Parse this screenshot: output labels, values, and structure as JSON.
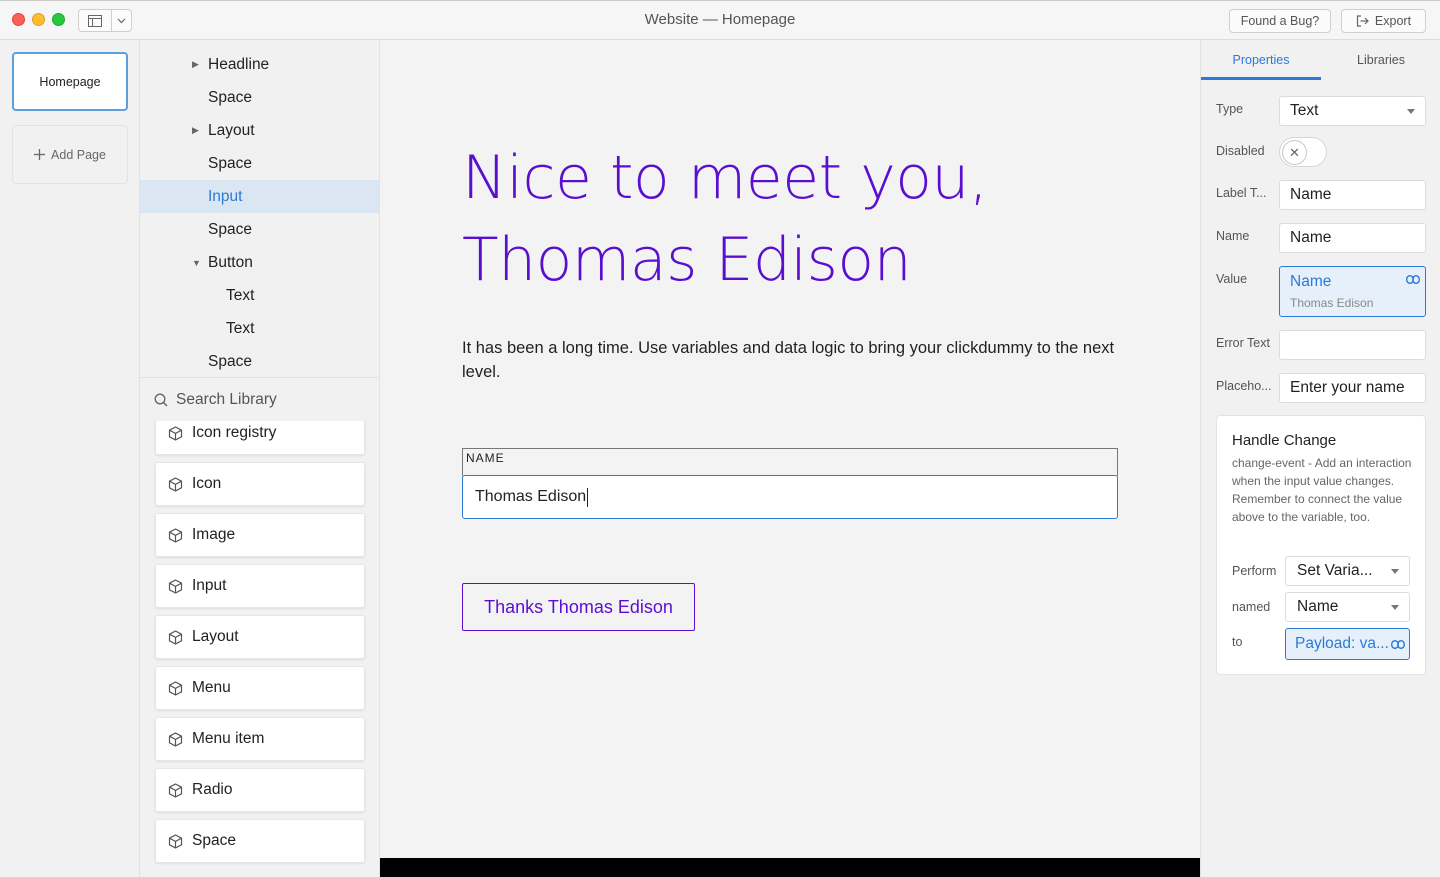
{
  "window": {
    "title": "Website — Homepage",
    "bug_button": "Found a Bug?",
    "export_button": "Export"
  },
  "pages": {
    "current": "Homepage",
    "add_label": "Add Page"
  },
  "tree": {
    "items": [
      {
        "label": "Headline",
        "indent": 1,
        "caret": "right",
        "selected": false
      },
      {
        "label": "Space",
        "indent": 1,
        "caret": "",
        "selected": false
      },
      {
        "label": "Layout",
        "indent": 1,
        "caret": "right",
        "selected": false
      },
      {
        "label": "Space",
        "indent": 1,
        "caret": "",
        "selected": false
      },
      {
        "label": "Input",
        "indent": 1,
        "caret": "",
        "selected": true
      },
      {
        "label": "Space",
        "indent": 1,
        "caret": "",
        "selected": false
      },
      {
        "label": "Button",
        "indent": 1,
        "caret": "down",
        "selected": false
      },
      {
        "label": "Text",
        "indent": 2,
        "caret": "",
        "selected": false
      },
      {
        "label": "Text",
        "indent": 2,
        "caret": "",
        "selected": false
      },
      {
        "label": "Space",
        "indent": 1,
        "caret": "",
        "selected": false
      }
    ]
  },
  "library": {
    "search_placeholder": "Search Library",
    "items": [
      "Icon registry",
      "Icon",
      "Image",
      "Input",
      "Layout",
      "Menu",
      "Menu item",
      "Radio",
      "Space"
    ]
  },
  "canvas": {
    "headline_line1": "Nice to meet you,",
    "headline_line2": "Thomas Edison",
    "body": "It has been a long time. Use variables and data logic to bring your clickdummy to the next level.",
    "field_label": "NAME",
    "field_value": "Thomas Edison",
    "button_label": "Thanks Thomas Edison"
  },
  "properties": {
    "tabs": [
      "Properties",
      "Libraries"
    ],
    "active_tab": "Properties",
    "type_label": "Type",
    "type_value": "Text",
    "disabled_label": "Disabled",
    "label_text_label": "Label T...",
    "label_text_value": "Name",
    "name_label": "Name",
    "name_value": "Name",
    "value_label": "Value",
    "value_main": "Name",
    "value_sub": "Thomas Edison",
    "error_label": "Error Text",
    "error_value": "",
    "placeholder_label": "Placeho...",
    "placeholder_value": "Enter your name"
  },
  "handle_change": {
    "title": "Handle Change",
    "description": "change-event - Add an interaction when the input value changes. Remember to connect the value above to the variable, too.",
    "perform_label": "Perform",
    "perform_value": "Set Varia...",
    "named_label": "named",
    "named_value": "Name",
    "to_label": "to",
    "to_value": "Payload: va..."
  },
  "colors": {
    "accent": "#2c7ad6",
    "brand_purple": "#5a0fd0",
    "selection_bg": "#dbe6f3"
  }
}
